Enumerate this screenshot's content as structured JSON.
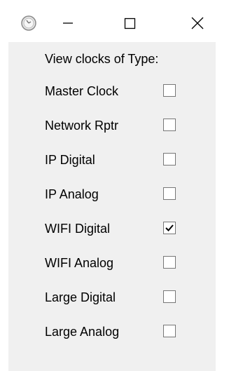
{
  "window": {
    "icon": "clock-icon",
    "controls": {
      "minimize": "minimize-icon",
      "maximize": "maximize-icon",
      "close": "close-icon"
    }
  },
  "content": {
    "header": "View clocks of Type:",
    "options": [
      {
        "label": "Master Clock",
        "checked": false
      },
      {
        "label": "Network Rptr",
        "checked": false
      },
      {
        "label": "IP Digital",
        "checked": false
      },
      {
        "label": "IP Analog",
        "checked": false
      },
      {
        "label": "WIFI Digital",
        "checked": true
      },
      {
        "label": "WIFI Analog",
        "checked": false
      },
      {
        "label": "Large Digital",
        "checked": false
      },
      {
        "label": "Large Analog",
        "checked": false
      }
    ]
  }
}
